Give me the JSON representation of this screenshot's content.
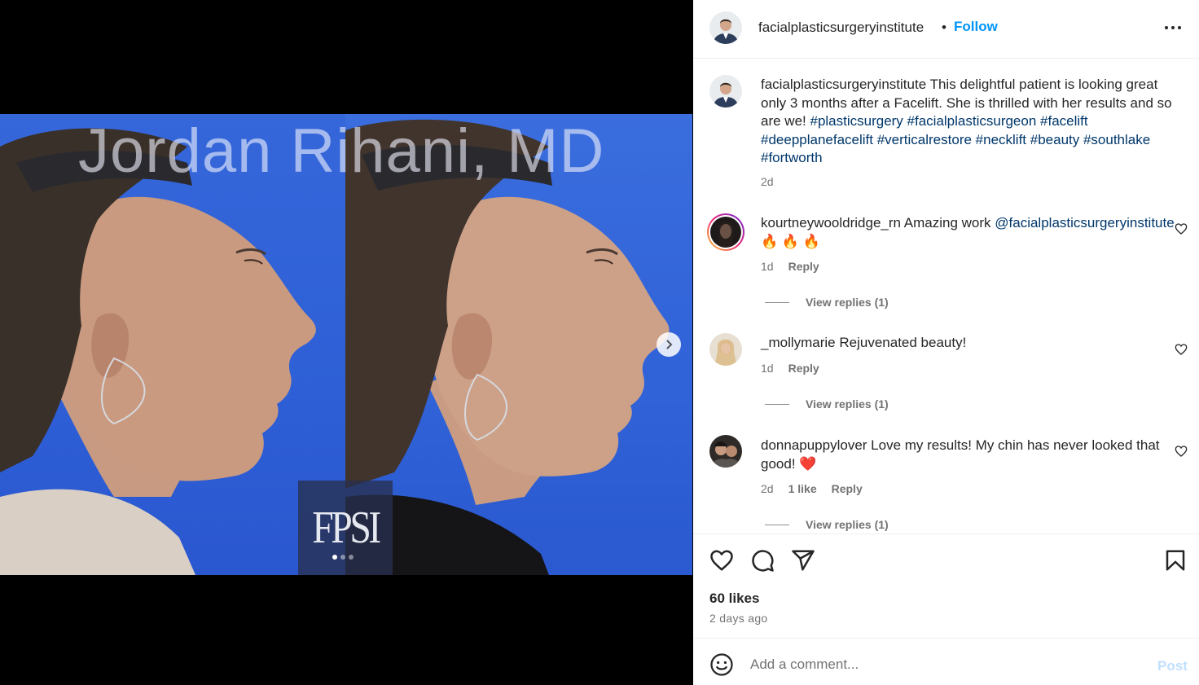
{
  "media": {
    "watermark": "Jordan Rihani, MD",
    "logo": "FPSI",
    "carousel_dots": 3,
    "active_dot": 0,
    "colors": {
      "backdrop": "#2f63d8"
    }
  },
  "header": {
    "username": "facialplasticsurgeryinstitute",
    "separator": "•",
    "follow_label": "Follow"
  },
  "caption": {
    "username": "facialplasticsurgeryinstitute",
    "text": " This delightful patient is looking great only 3 months after a Facelift. She is thrilled with her results and so are we! ",
    "hashtags": "#plasticsurgery #facialplasticsurgeon #facelift #deepplanefacelift #verticalrestore #necklift #beauty #southlake #fortworth",
    "time": "2d"
  },
  "comments": [
    {
      "username": "kourtneywooldridge_rn",
      "text": " Amazing work ",
      "mention": "@facialplasticsurgeryinstitute",
      "emoji": " 🔥 🔥 🔥",
      "time": "1d",
      "likes": "",
      "reply_label": "Reply",
      "view_replies": "View replies (1)"
    },
    {
      "username": "_mollymarie",
      "text": " Rejuvenated beauty!",
      "mention": "",
      "emoji": "",
      "time": "1d",
      "likes": "",
      "reply_label": "Reply",
      "view_replies": "View replies (1)"
    },
    {
      "username": "donnapuppylover",
      "text": " Love my results! My chin has never looked that good! ",
      "mention": "",
      "emoji": "❤️",
      "time": "2d",
      "likes": "1 like",
      "reply_label": "Reply",
      "view_replies": "View replies (1)"
    }
  ],
  "actions": {
    "like_icon": "heart-icon",
    "comment_icon": "comment-bubble-icon",
    "share_icon": "paper-plane-icon",
    "save_icon": "bookmark-icon"
  },
  "likes": "60 likes",
  "posted": "2 days ago",
  "add_comment": {
    "placeholder": "Add a comment...",
    "post_label": "Post"
  },
  "colors": {
    "accent": "#0095f6",
    "hashtag": "#00376b",
    "muted": "#737373",
    "post_disabled": "#c0dffd"
  }
}
